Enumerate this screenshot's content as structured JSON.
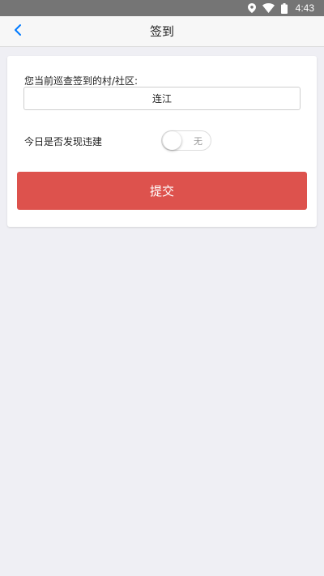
{
  "status_bar": {
    "time": "4:43",
    "icons": [
      "location-icon",
      "wifi-icon",
      "battery-icon"
    ]
  },
  "nav": {
    "title": "签到",
    "back_icon": "chevron-left-icon",
    "accent_color": "#007aff"
  },
  "form": {
    "village_label": "您当前巡查签到的村/社区:",
    "village_value": "连江",
    "violation_label": "今日是否发现违建",
    "violation_toggle_text": "无",
    "violation_toggle_on": false,
    "submit_label": "提交",
    "submit_color": "#dd524d"
  }
}
